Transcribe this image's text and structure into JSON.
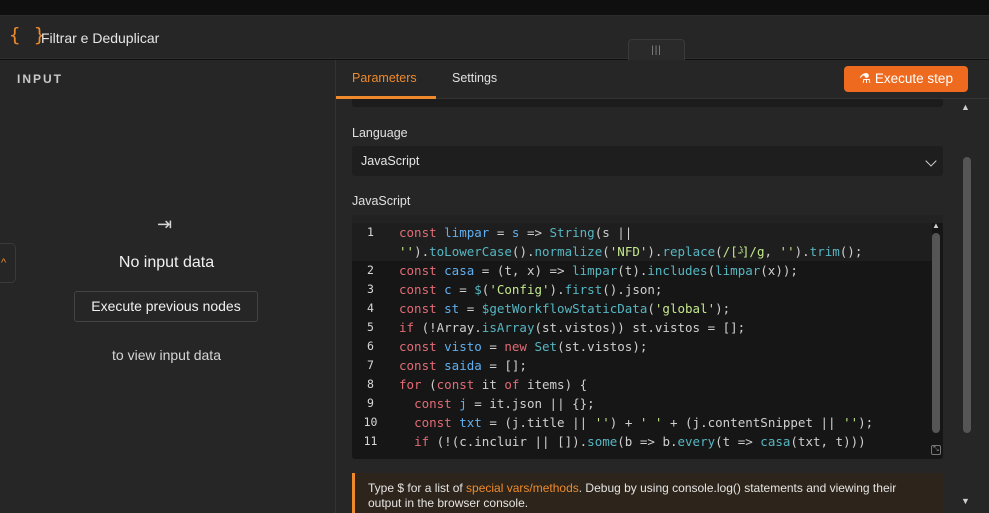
{
  "node": {
    "braces_icon": "{ }",
    "title": "Filtrar e Deduplicar"
  },
  "drag_handle": {
    "glyph": "|||"
  },
  "input_panel": {
    "title": "INPUT",
    "edge_glyph": "^",
    "arrow_icon": "⇥",
    "empty_title": "No input data",
    "execute_previous_label": "Execute previous nodes",
    "helper_text": "to view input data"
  },
  "tabs": [
    {
      "label": "Parameters",
      "active": true
    },
    {
      "label": "Settings",
      "active": false
    }
  ],
  "execute_step": {
    "icon": "flask-icon",
    "icon_glyph": "⚗",
    "label": "Execute step"
  },
  "language": {
    "label": "Language",
    "value": "JavaScript"
  },
  "code_section": {
    "label": "JavaScript"
  },
  "code_lines": [
    {
      "num": "1",
      "segments": [
        [
          "k",
          "const "
        ],
        [
          "v",
          "limpar"
        ],
        [
          "o",
          " = "
        ],
        [
          "v",
          "s"
        ],
        [
          "o",
          " => "
        ],
        [
          "f",
          "String"
        ],
        [
          "p",
          "(s "
        ],
        [
          "o",
          "||"
        ]
      ]
    },
    {
      "num": "",
      "segments": [
        [
          "s",
          "''"
        ],
        [
          "p",
          ")."
        ],
        [
          "f",
          "toLowerCase"
        ],
        [
          "p",
          "()."
        ],
        [
          "f",
          "normalize"
        ],
        [
          "p",
          "("
        ],
        [
          "s",
          "'NFD'"
        ],
        [
          "p",
          ")."
        ],
        [
          "f",
          "replace"
        ],
        [
          "p",
          "("
        ],
        [
          "s",
          "/[̀-ͯ]/g"
        ],
        [
          "p",
          ", "
        ],
        [
          "s",
          "''"
        ],
        [
          "p",
          ")."
        ],
        [
          "f",
          "trim"
        ],
        [
          "p",
          "();"
        ]
      ]
    },
    {
      "num": "2",
      "segments": [
        [
          "k",
          "const "
        ],
        [
          "v",
          "casa"
        ],
        [
          "o",
          " = "
        ],
        [
          "p",
          "(t, x) "
        ],
        [
          "o",
          "=> "
        ],
        [
          "f",
          "limpar"
        ],
        [
          "p",
          "(t)."
        ],
        [
          "f",
          "includes"
        ],
        [
          "p",
          "("
        ],
        [
          "f",
          "limpar"
        ],
        [
          "p",
          "(x));"
        ]
      ]
    },
    {
      "num": "3",
      "segments": [
        [
          "k",
          "const "
        ],
        [
          "v",
          "c"
        ],
        [
          "o",
          " = "
        ],
        [
          "f",
          "$"
        ],
        [
          "p",
          "("
        ],
        [
          "s",
          "'Config'"
        ],
        [
          "p",
          ")."
        ],
        [
          "f",
          "first"
        ],
        [
          "p",
          "().json;"
        ]
      ]
    },
    {
      "num": "4",
      "segments": [
        [
          "k",
          "const "
        ],
        [
          "v",
          "st"
        ],
        [
          "o",
          " = "
        ],
        [
          "f",
          "$getWorkflowStaticData"
        ],
        [
          "p",
          "("
        ],
        [
          "s",
          "'global'"
        ],
        [
          "p",
          ");"
        ]
      ]
    },
    {
      "num": "5",
      "segments": [
        [
          "k",
          "if "
        ],
        [
          "p",
          "(!Array."
        ],
        [
          "f",
          "isArray"
        ],
        [
          "p",
          "(st.vistos)) st.vistos "
        ],
        [
          "o",
          "="
        ],
        [
          "p",
          " [];"
        ]
      ]
    },
    {
      "num": "6",
      "segments": [
        [
          "k",
          "const "
        ],
        [
          "v",
          "visto"
        ],
        [
          "o",
          " = "
        ],
        [
          "k",
          "new "
        ],
        [
          "f",
          "Set"
        ],
        [
          "p",
          "(st.vistos);"
        ]
      ]
    },
    {
      "num": "7",
      "segments": [
        [
          "k",
          "const "
        ],
        [
          "v",
          "saida"
        ],
        [
          "o",
          " = "
        ],
        [
          "p",
          "[];"
        ]
      ]
    },
    {
      "num": "8",
      "segments": [
        [
          "k",
          "for "
        ],
        [
          "p",
          "("
        ],
        [
          "k",
          "const "
        ],
        [
          "p",
          "it "
        ],
        [
          "k",
          "of "
        ],
        [
          "p",
          "items) {"
        ]
      ]
    },
    {
      "num": "9",
      "segments": [
        [
          "p",
          "  "
        ],
        [
          "k",
          "const "
        ],
        [
          "v",
          "j"
        ],
        [
          "o",
          " = "
        ],
        [
          "p",
          "it.json "
        ],
        [
          "o",
          "|| "
        ],
        [
          "p",
          "{};"
        ]
      ]
    },
    {
      "num": "10",
      "segments": [
        [
          "p",
          "  "
        ],
        [
          "k",
          "const "
        ],
        [
          "v",
          "txt"
        ],
        [
          "o",
          " = "
        ],
        [
          "p",
          "(j.title "
        ],
        [
          "o",
          "|| "
        ],
        [
          "s",
          "''"
        ],
        [
          "p",
          ") "
        ],
        [
          "o",
          "+ "
        ],
        [
          "s",
          "' '"
        ],
        [
          "o",
          " + "
        ],
        [
          "p",
          "(j.contentSnippet "
        ],
        [
          "o",
          "|| "
        ],
        [
          "s",
          "''"
        ],
        [
          "p",
          ");"
        ]
      ]
    },
    {
      "num": "11",
      "segments": [
        [
          "p",
          "  "
        ],
        [
          "k",
          "if "
        ],
        [
          "p",
          "(!(c.incluir "
        ],
        [
          "o",
          "|| "
        ],
        [
          "p",
          "[])."
        ],
        [
          "f",
          "some"
        ],
        [
          "p",
          "(b "
        ],
        [
          "o",
          "=> "
        ],
        [
          "p",
          "b."
        ],
        [
          "f",
          "every"
        ],
        [
          "p",
          "(t "
        ],
        [
          "o",
          "=> "
        ],
        [
          "f",
          "casa"
        ],
        [
          "p",
          "(txt, t)))"
        ]
      ]
    }
  ],
  "hint": {
    "before": "Type $ for a list of ",
    "link": "special vars/methods",
    "after": ". Debug by using console.log() statements and viewing their output in the browser console."
  },
  "colors": {
    "accent": "#ee8a2c",
    "execute_button": "#ee6a1f",
    "panel": "#262626",
    "editor": "#161616"
  }
}
